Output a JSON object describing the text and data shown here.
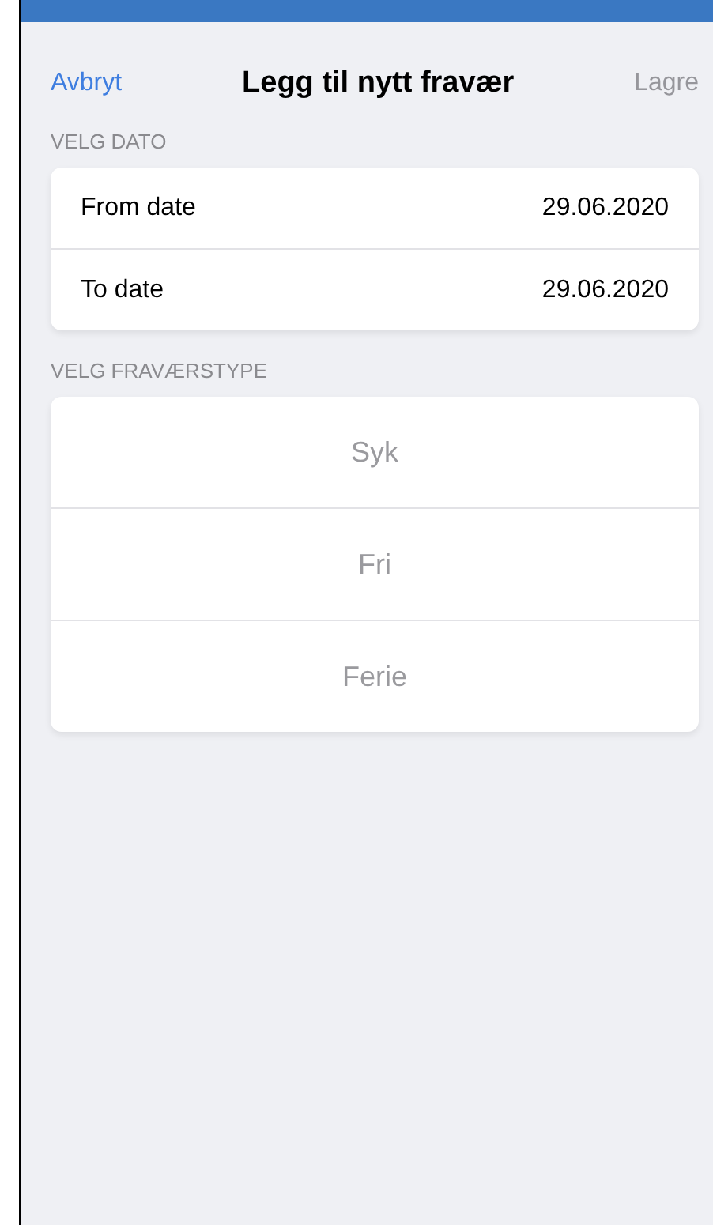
{
  "nav": {
    "cancel": "Avbryt",
    "title": "Legg til nytt fravær",
    "save": {
      "label": "Lagre",
      "disabled": true
    }
  },
  "date_section": {
    "header": "VELG DATO",
    "rows": [
      {
        "label": "From date",
        "value": "29.06.2020"
      },
      {
        "label": "To date",
        "value": "29.06.2020"
      }
    ]
  },
  "type_section": {
    "header": "VELG FRAVÆRSTYPE",
    "options": [
      {
        "label": "Syk",
        "selected": false
      },
      {
        "label": "Fri",
        "selected": false
      },
      {
        "label": "Ferie",
        "selected": false
      }
    ]
  }
}
